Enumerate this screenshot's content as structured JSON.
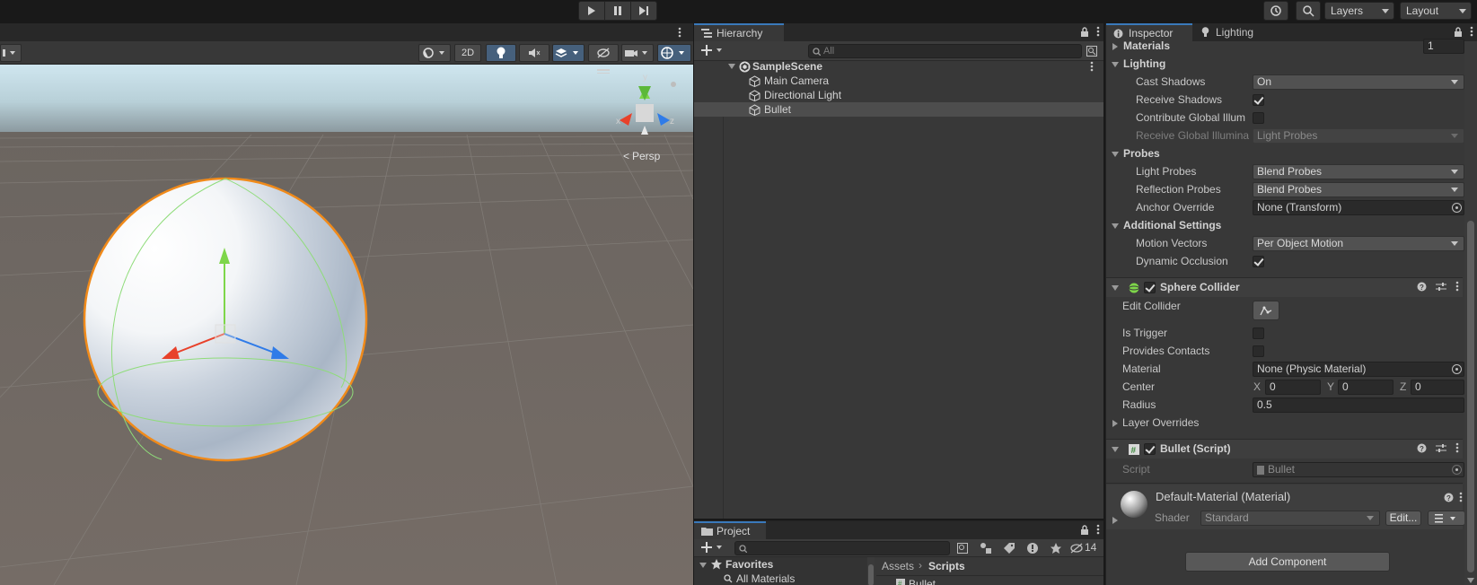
{
  "toolbar": {
    "play_icon": "play-icon",
    "pause_icon": "pause-icon",
    "step_icon": "step-icon",
    "layers_label": "Layers",
    "layout_label": "Layout"
  },
  "scene": {
    "toolbar_2d_label": "2D",
    "persp_label": "Persp",
    "axis_y": "y",
    "axis_x": "x",
    "axis_z": "z"
  },
  "hierarchy": {
    "tab_label": "Hierarchy",
    "search_placeholder": "All",
    "scene_name": "SampleScene",
    "items": [
      {
        "label": "Main Camera"
      },
      {
        "label": "Directional Light"
      },
      {
        "label": "Bullet"
      }
    ]
  },
  "project": {
    "tab_label": "Project",
    "favorites_label": "Favorites",
    "all_materials_label": "All Materials",
    "breadcrumb_root": "Assets",
    "breadcrumb_current": "Scripts",
    "hidden_count": "14",
    "file_item": "Bullet"
  },
  "inspector": {
    "tab_label": "Inspector",
    "lighting_tab_label": "Lighting",
    "materials_label": "Materials",
    "materials_count": "1",
    "lighting_section": "Lighting",
    "cast_shadows_label": "Cast Shadows",
    "cast_shadows_value": "On",
    "receive_shadows_label": "Receive Shadows",
    "contribute_gi_label": "Contribute Global Illum",
    "receive_gi_label": "Receive Global Illumina",
    "receive_gi_value": "Light Probes",
    "probes_section": "Probes",
    "light_probes_label": "Light Probes",
    "light_probes_value": "Blend Probes",
    "reflection_probes_label": "Reflection Probes",
    "reflection_probes_value": "Blend Probes",
    "anchor_override_label": "Anchor Override",
    "anchor_override_value": "None (Transform)",
    "additional_section": "Additional Settings",
    "motion_vectors_label": "Motion Vectors",
    "motion_vectors_value": "Per Object Motion",
    "dynamic_occlusion_label": "Dynamic Occlusion",
    "sphere_collider": {
      "title": "Sphere Collider",
      "edit_collider_label": "Edit Collider",
      "is_trigger_label": "Is Trigger",
      "provides_contacts_label": "Provides Contacts",
      "material_label": "Material",
      "material_value": "None (Physic Material)",
      "center_label": "Center",
      "x_label": "X",
      "x_value": "0",
      "y_label": "Y",
      "y_value": "0",
      "z_label": "Z",
      "z_value": "0",
      "radius_label": "Radius",
      "radius_value": "0.5",
      "layer_overrides_label": "Layer Overrides"
    },
    "bullet_script": {
      "title": "Bullet (Script)",
      "script_label": "Script",
      "script_value": "Bullet"
    },
    "material": {
      "title": "Default-Material (Material)",
      "shader_label": "Shader",
      "shader_value": "Standard",
      "edit_label": "Edit..."
    },
    "add_component_label": "Add Component"
  },
  "colors": {
    "selection_outline": "#f08a1a",
    "axis_x": "#e8412a",
    "axis_y": "#7ed64a",
    "axis_z": "#2f7be8",
    "accent_tab": "#3a79bb"
  }
}
